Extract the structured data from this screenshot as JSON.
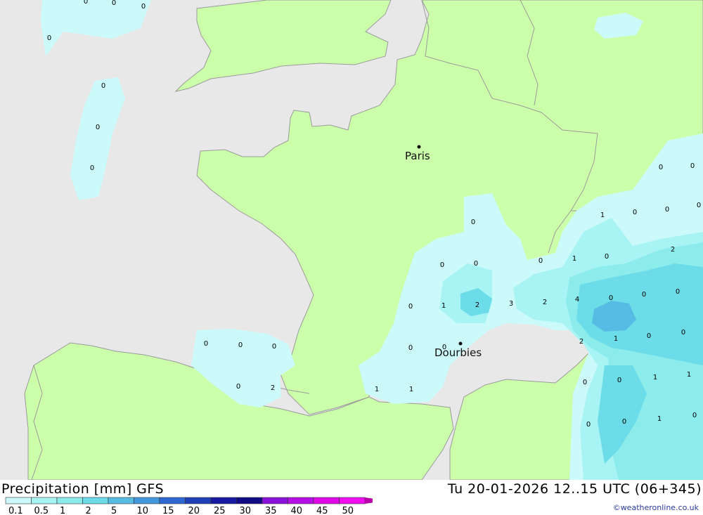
{
  "title": "Precipitation [mm] GFS",
  "datetime": "Tu 20-01-2026 12..15 UTC (06+345)",
  "credit": "©weatheronline.co.uk",
  "colors": {
    "sea": "#e8e8e8",
    "land": "#ccffaa",
    "border": "#999999",
    "scale": [
      "#ccfafa",
      "#a8f4f4",
      "#8cecec",
      "#6cdce8",
      "#56bce4",
      "#4296dc",
      "#2f68d2",
      "#2040b8",
      "#1818a0",
      "#100a86",
      "#8a12d8",
      "#b50ee6",
      "#e00ae8",
      "#f00ef0",
      "#d10cc0",
      "#b800aa"
    ]
  },
  "legend": {
    "labels": [
      "0.1",
      "0.5",
      "1",
      "2",
      "5",
      "10",
      "15",
      "20",
      "25",
      "30",
      "35",
      "40",
      "45",
      "50"
    ]
  },
  "cities": [
    {
      "name": "Paris"
    },
    {
      "name": "Dourbies"
    }
  ],
  "values": [
    "0",
    "0",
    "0",
    "0",
    "0",
    "0",
    "0",
    "0",
    "0",
    "0",
    "0",
    "1",
    "0",
    "0",
    "0",
    "1",
    "0",
    "0",
    "0",
    "2",
    "0",
    "1",
    "2",
    "3",
    "2",
    "4",
    "0",
    "0",
    "0",
    "0",
    "0",
    "0",
    "0",
    "0",
    "2",
    "1",
    "0",
    "0",
    "0",
    "2",
    "1",
    "1",
    "0",
    "0",
    "1",
    "1",
    "0",
    "0",
    "1",
    "0"
  ]
}
